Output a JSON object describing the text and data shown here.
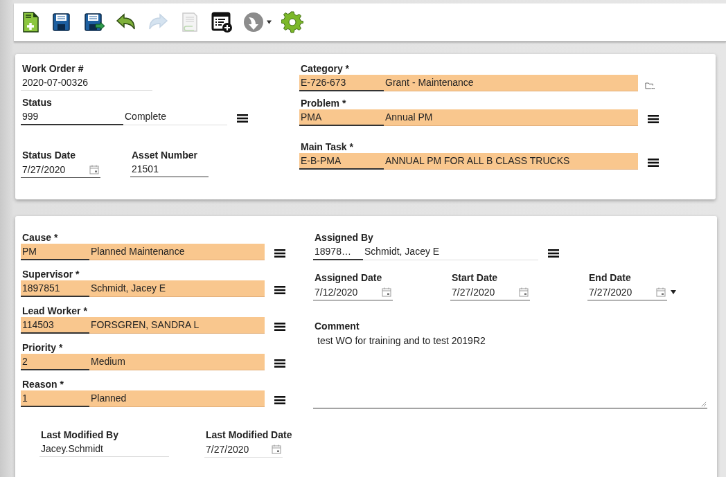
{
  "toolbar": [
    {
      "kind": "new",
      "disabled": false
    },
    {
      "kind": "save",
      "disabled": false
    },
    {
      "kind": "saveas",
      "disabled": false
    },
    {
      "kind": "undo",
      "disabled": false
    },
    {
      "kind": "redo",
      "disabled": true
    },
    {
      "kind": "attach",
      "disabled": true
    },
    {
      "kind": "addlist",
      "disabled": false
    },
    {
      "kind": "workflow",
      "disabled": true,
      "dropdown": true
    },
    {
      "kind": "settings",
      "disabled": false
    }
  ],
  "header": {
    "work_order": {
      "label": "Work Order #",
      "value": "2020-07-00326",
      "readonly": true
    },
    "status": {
      "label": "Status",
      "code": "999",
      "description": "Complete",
      "required": false,
      "kind": "list"
    },
    "status_date": {
      "label": "Status Date",
      "value": "7/27/2020",
      "readonly": false,
      "dropdown": false
    },
    "asset_number": {
      "label": "Asset Number",
      "value": "21501",
      "readonly": false
    },
    "category": {
      "label": "Category *",
      "code": "E-726-673",
      "description": "Grant - Maintenance",
      "required": true,
      "kind": "folder"
    },
    "problem": {
      "label": "Problem *",
      "code": "PMA",
      "description": "Annual PM",
      "required": true,
      "kind": "list"
    },
    "main_task": {
      "label": "Main Task *",
      "code": "E-B-PMA",
      "description": "ANNUAL PM FOR ALL B CLASS TRUCKS",
      "required": true,
      "kind": "list"
    }
  },
  "details": {
    "cause": {
      "label": "Cause *",
      "code": "PM",
      "description": "Planned Maintenance",
      "required": true,
      "kind": "list"
    },
    "supervisor": {
      "label": "Supervisor *",
      "code": "1897851",
      "description": "Schmidt, Jacey E",
      "required": true,
      "kind": "list"
    },
    "lead_worker": {
      "label": "Lead Worker *",
      "code": "114503",
      "description": "FORSGREN, SANDRA L",
      "required": true,
      "kind": "list"
    },
    "priority": {
      "label": "Priority *",
      "code": "2",
      "description": "Medium",
      "required": true,
      "kind": "list"
    },
    "reason": {
      "label": "Reason *",
      "code": "1",
      "description": "Planned",
      "required": true,
      "kind": "list"
    },
    "last_modified_by": {
      "label": "Last Modified By",
      "value": "Jacey.Schmidt",
      "readonly": true
    },
    "last_modified_date": {
      "label": "Last Modified Date",
      "value": "7/27/2020",
      "readonly": true,
      "dropdown": false
    },
    "assigned_by": {
      "label": "Assigned By",
      "code": "18978…",
      "description": "Schmidt, Jacey E",
      "required": false,
      "kind": "list"
    },
    "assigned_date": {
      "label": "Assigned Date",
      "value": "7/12/2020",
      "readonly": false,
      "dropdown": false
    },
    "start_date": {
      "label": "Start Date",
      "value": "7/27/2020",
      "readonly": false,
      "dropdown": false
    },
    "end_date": {
      "label": "End Date",
      "value": "7/27/2020",
      "readonly": false,
      "dropdown": true
    },
    "comment": {
      "label": "Comment",
      "value": "test WO for training and to test 2019R2"
    }
  }
}
